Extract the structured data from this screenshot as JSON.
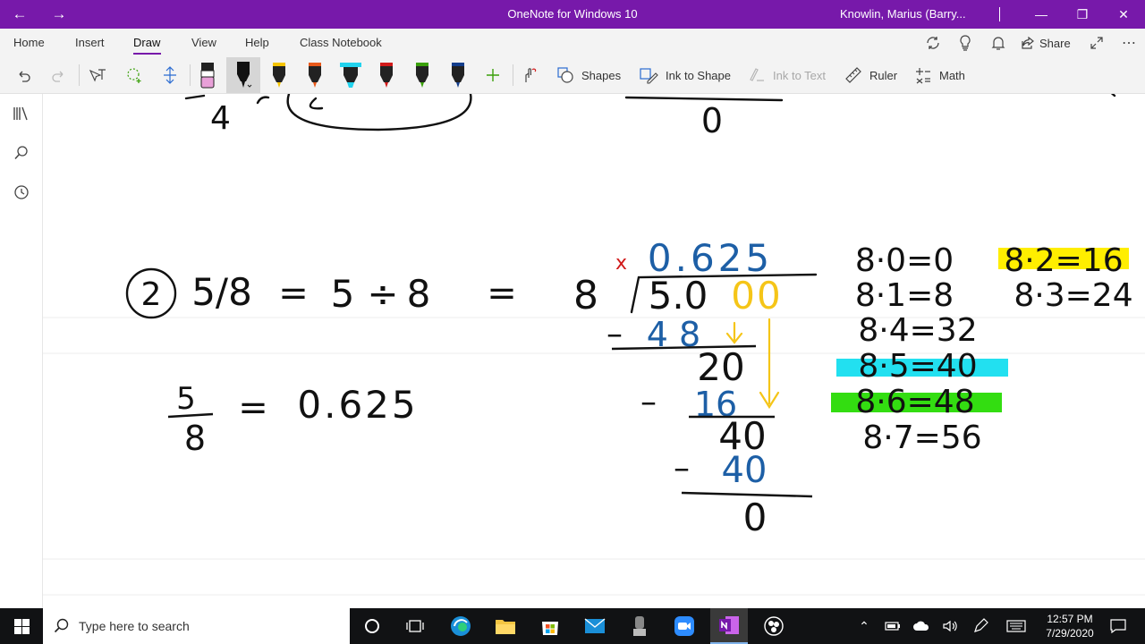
{
  "titlebar": {
    "title": "OneNote for Windows 10",
    "user": "Knowlin, Marius (Barry...",
    "bg_color": "#7719aa"
  },
  "menu": {
    "tabs": [
      "Home",
      "Insert",
      "Draw",
      "View",
      "Help",
      "Class Notebook"
    ],
    "active_tab": "Draw",
    "share_label": "Share"
  },
  "ribbon": {
    "shapes_label": "Shapes",
    "ink_to_shape_label": "Ink to Shape",
    "ink_to_text_label": "Ink to Text",
    "ruler_label": "Ruler",
    "math_label": "Math",
    "pens": [
      {
        "name": "eraser",
        "color": "#e8a0d8"
      },
      {
        "name": "black-pen",
        "color": "#111111"
      },
      {
        "name": "yellow-pen",
        "color": "#f5c400"
      },
      {
        "name": "orange-pen",
        "color": "#e8591a"
      },
      {
        "name": "cyan-highlighter",
        "color": "#22d3ee"
      },
      {
        "name": "red-pen",
        "color": "#d11a1a"
      },
      {
        "name": "green-pen",
        "color": "#3aa00a"
      },
      {
        "name": "navy-pen",
        "color": "#143e8c"
      }
    ]
  },
  "note": {
    "problem_number": "2",
    "fraction": "5/8",
    "equals": "=",
    "dividend_expr": "5",
    "divide_sign": "÷",
    "divisor_expr": "8",
    "result_numerator": "5",
    "result_denominator": "8",
    "result_value": "0.625",
    "top_fragment_digit": "4",
    "top_zero": "0",
    "division": {
      "mark": "x",
      "quotient": "0.625",
      "divisor": "8",
      "dividend": "5.0",
      "appended_zeros": "00",
      "sub1": "4 8",
      "rem1": "20",
      "sub2": "16",
      "rem2": "40",
      "sub3": "40",
      "remainder": "0",
      "minus": "–"
    },
    "facts": [
      "8·0=0",
      "8·1=8",
      "8·4=32",
      "8·5=40",
      "8·6=48",
      "8·7=56",
      "8·2=16",
      "8·3=24"
    ],
    "highlight_colors": {
      "yellow": "#ffee00",
      "cyan": "#22e0f0",
      "green": "#33dd11"
    },
    "ink_colors": {
      "black": "#111111",
      "blue": "#1d5fa6",
      "yellow": "#f5c518",
      "red": "#d11a1a"
    }
  },
  "taskbar": {
    "search_placeholder": "Type here to search",
    "time": "12:57 PM",
    "date": "7/29/2020"
  }
}
